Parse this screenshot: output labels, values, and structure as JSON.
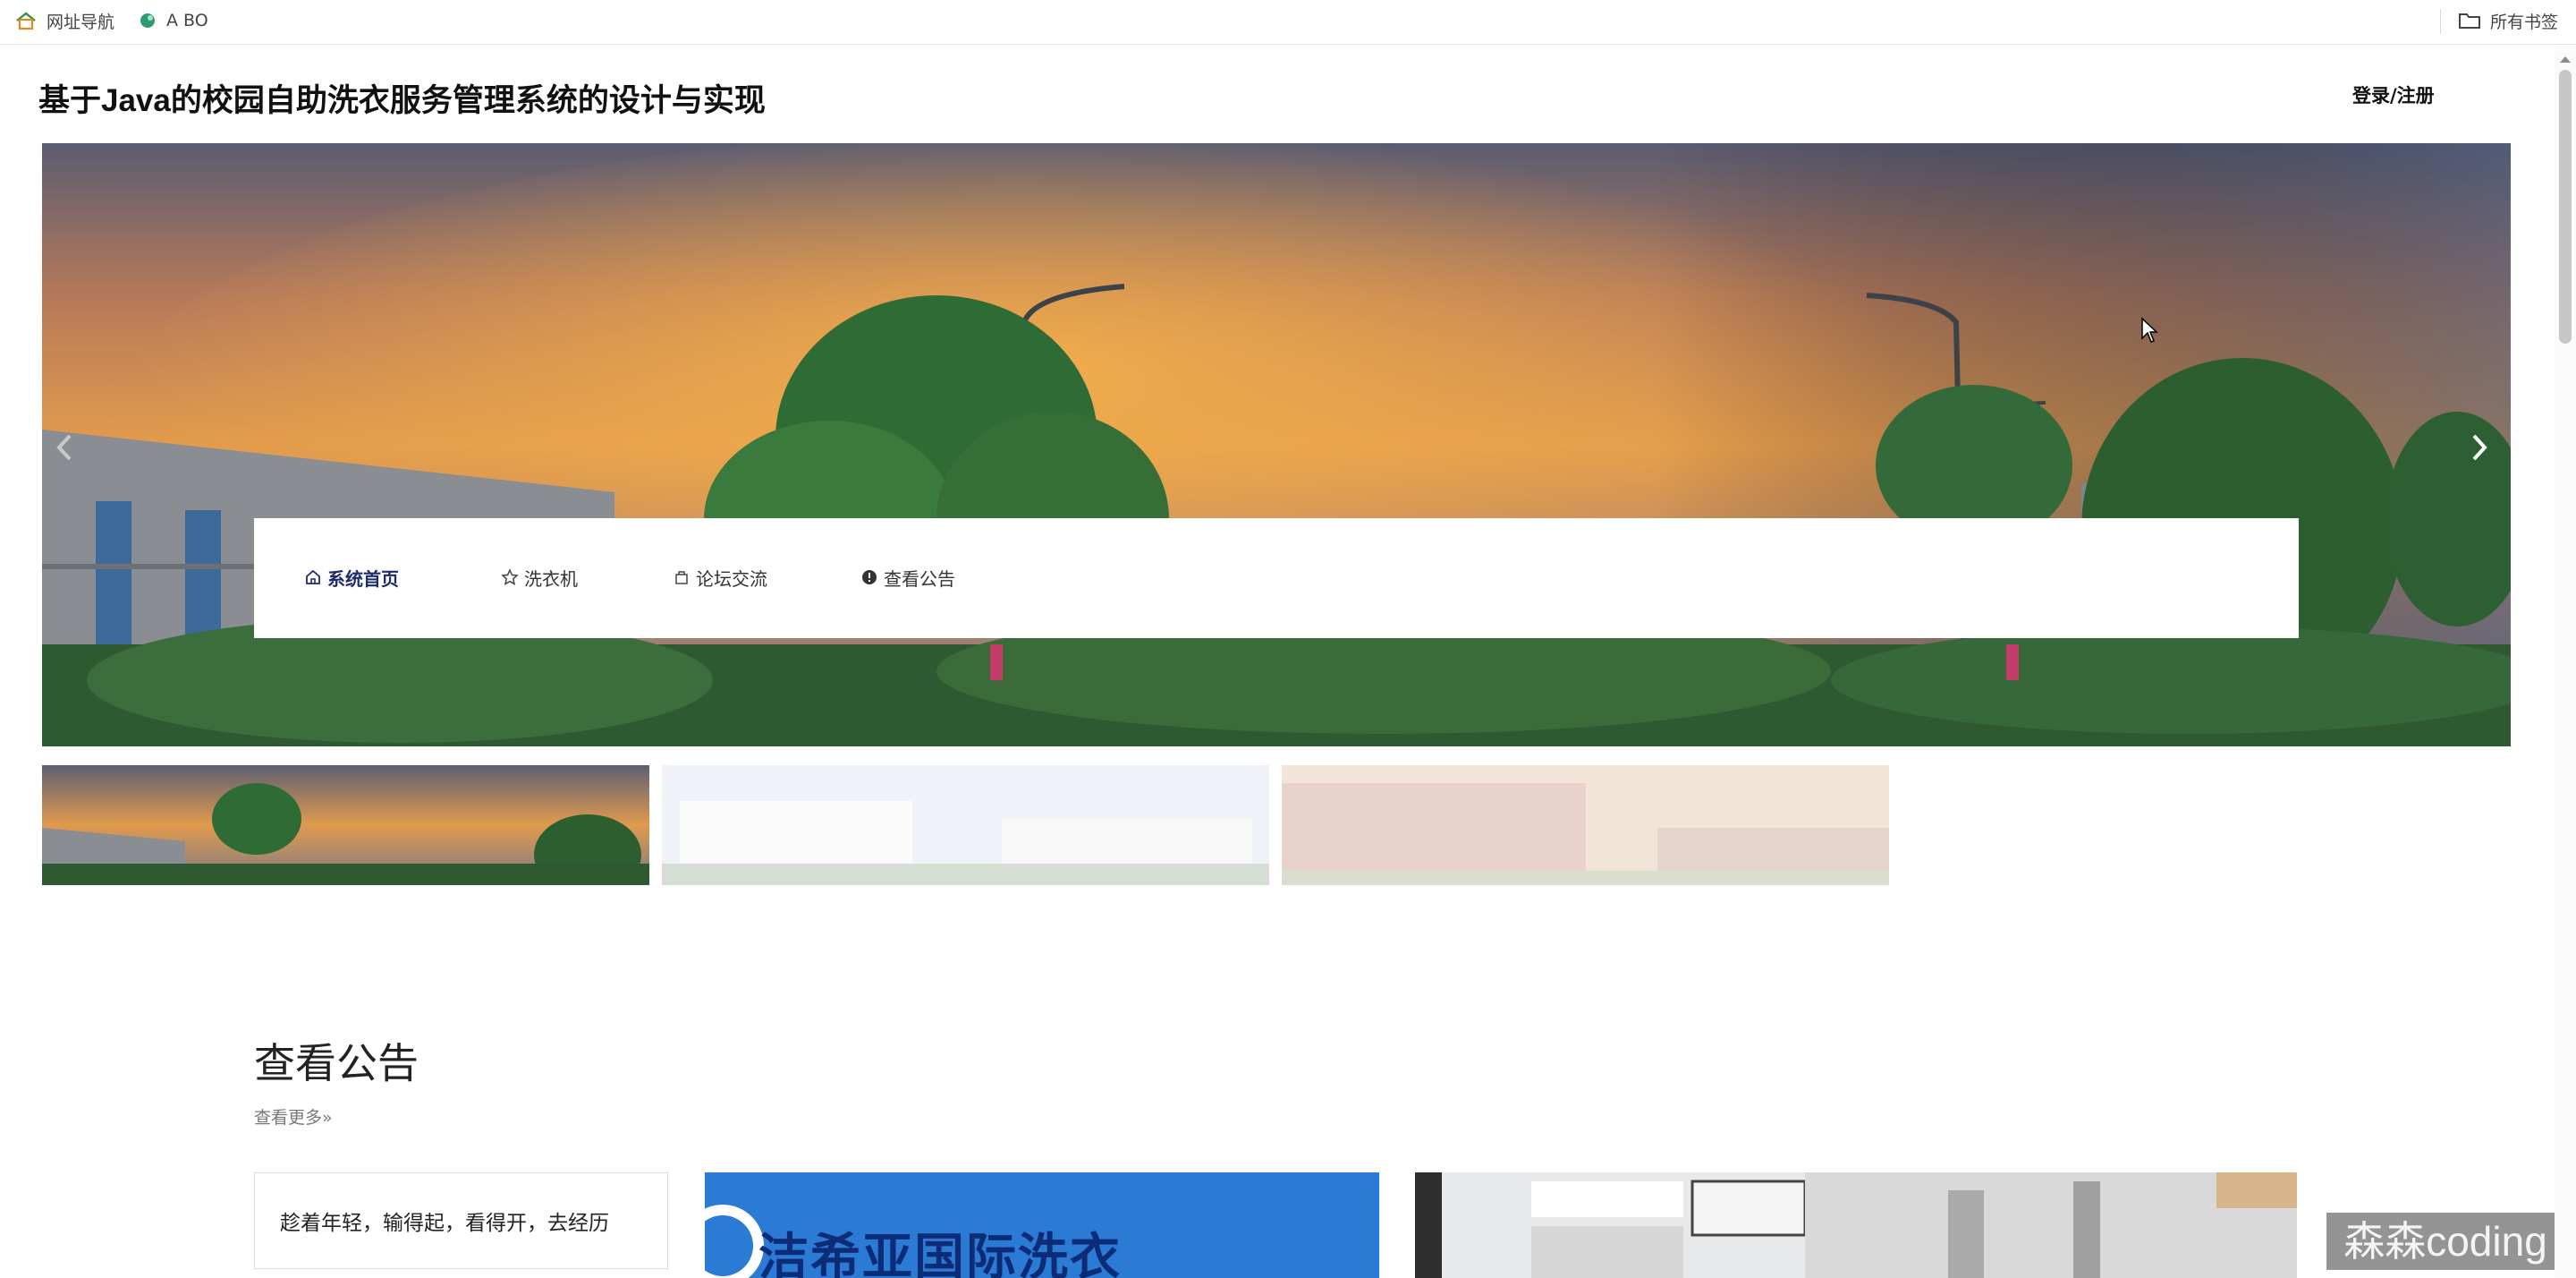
{
  "bookmarks": {
    "items": [
      {
        "label": "网址导航",
        "icon": "home-icon"
      },
      {
        "label": "A BO",
        "icon": "bird-icon"
      }
    ],
    "all_bookmarks": "所有书签"
  },
  "header": {
    "title": "基于Java的校园自助洗衣服务管理系统的设计与实现",
    "login": "登录/注册"
  },
  "nav": {
    "items": [
      {
        "label": "系统首页",
        "icon": "home-icon",
        "active": true
      },
      {
        "label": "洗衣机",
        "icon": "star-icon",
        "active": false
      },
      {
        "label": "论坛交流",
        "icon": "bag-icon",
        "active": false
      },
      {
        "label": "查看公告",
        "icon": "info-icon",
        "active": false
      }
    ]
  },
  "notices": {
    "title": "查看公告",
    "more": "查看更多»",
    "first_card": "趁着年轻，输得起，看得开，去经历",
    "brand_image_text": "洁希亚国际洗衣"
  },
  "watermark": "森森coding"
}
